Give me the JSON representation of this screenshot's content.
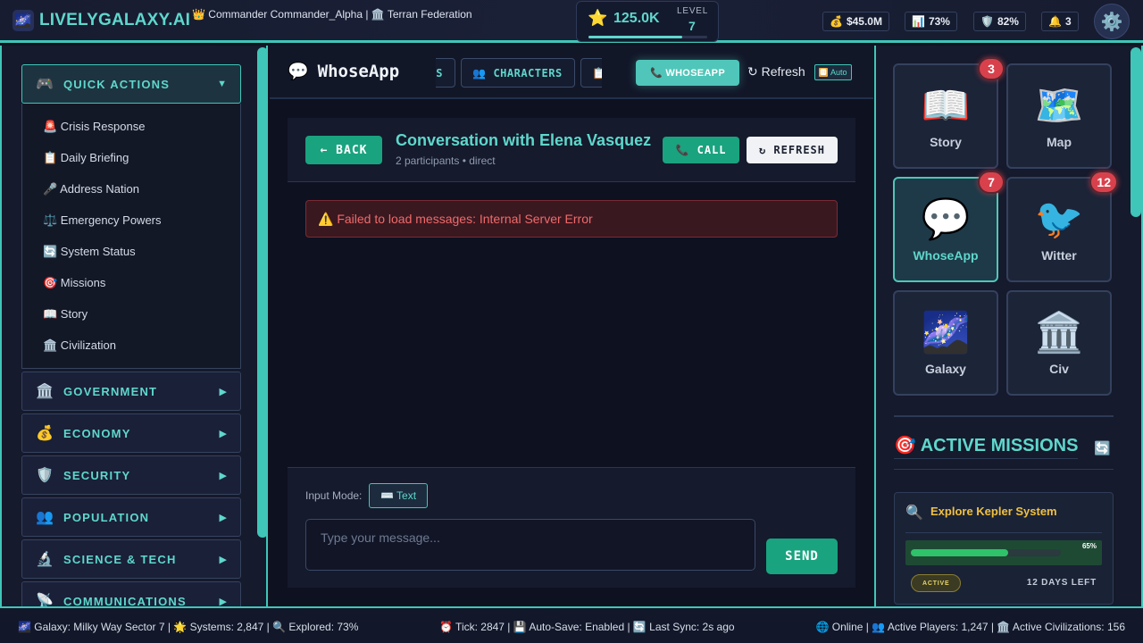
{
  "header": {
    "logo_icon": "🌌",
    "logo_text": "LIVELYGALAXY.AI",
    "commander": "👑 Commander Commander_Alpha | 🏛️ Terran Federation",
    "xp": "125.0K",
    "xp_progress": 0.79,
    "level_label": "LEVEL",
    "level": "7",
    "stats": [
      {
        "icon": "💰",
        "value": "$45.0M"
      },
      {
        "icon": "📊",
        "value": "73%"
      },
      {
        "icon": "🛡️",
        "value": "82%"
      },
      {
        "icon": "🔔",
        "value": "3"
      }
    ],
    "settings_icon": "⚙️"
  },
  "sidebar": {
    "quick_actions": {
      "icon": "🎮",
      "label": "QUICK ACTIONS",
      "arrow": "▼"
    },
    "quick_items": [
      "🚨 Crisis Response",
      "📋 Daily Briefing",
      "🎤 Address Nation",
      "⚖️ Emergency Powers",
      "🔄 System Status",
      "🎯 Missions",
      "📖 Story",
      "🏛️ Civilization"
    ],
    "categories": [
      {
        "icon": "🏛️",
        "label": "GOVERNMENT",
        "arrow": "▶"
      },
      {
        "icon": "💰",
        "label": "ECONOMY",
        "arrow": "▶"
      },
      {
        "icon": "🛡️",
        "label": "SECURITY",
        "arrow": "▶"
      },
      {
        "icon": "👥",
        "label": "POPULATION",
        "arrow": "▶"
      },
      {
        "icon": "🔬",
        "label": "SCIENCE & TECH",
        "arrow": "▶"
      },
      {
        "icon": "📡",
        "label": "COMMUNICATIONS",
        "arrow": "▶"
      }
    ]
  },
  "center": {
    "app_icon": "💬",
    "app_title": "WhoseApp",
    "tabs": [
      {
        "icon": "",
        "label": "S"
      },
      {
        "icon": "👥",
        "label": "CHARACTERS"
      },
      {
        "icon": "📋",
        "label": ""
      }
    ],
    "whoseapp_button": "📞 WHOSEAPP",
    "refresh_link": "↻ Refresh",
    "auto_icon": "🅷",
    "auto_label": "Auto",
    "back_button": "← BACK",
    "conversation_title": "Conversation with Elena Vasquez",
    "conversation_meta": "2 participants • direct",
    "call_button": "📞 CALL",
    "refresh_button": "↻ REFRESH",
    "error": "⚠️ Failed to load messages: Internal Server Error",
    "input_mode_label": "Input Mode:",
    "input_mode_value": "⌨️ Text",
    "message_placeholder": "Type your message...",
    "send_button": "SEND"
  },
  "right": {
    "apps": [
      {
        "emoji": "📖",
        "label": "Story",
        "badge": "3",
        "active": false
      },
      {
        "emoji": "🗺️",
        "label": "Map",
        "badge": "",
        "active": false
      },
      {
        "emoji": "💬",
        "label": "WhoseApp",
        "badge": "7",
        "active": true
      },
      {
        "emoji": "🐦",
        "label": "Witter",
        "badge": "12",
        "active": false
      },
      {
        "emoji": "🌌",
        "label": "Galaxy",
        "badge": "",
        "active": false
      },
      {
        "emoji": "🏛️",
        "label": "Civ",
        "badge": "",
        "active": false
      }
    ],
    "missions_title": "🎯 ACTIVE MISSIONS",
    "missions_refresh": "🔄",
    "mission": {
      "icon": "🔍",
      "name": "Explore Kepler System",
      "progress": 0.65,
      "progress_label": "65%",
      "status": "ACTIVE",
      "days_left": "12 DAYS LEFT"
    }
  },
  "footer": {
    "left": "🌌 Galaxy: Milky Way Sector 7 | 🌟 Systems: 2,847 | 🔍 Explored: 73%",
    "center": "⏰ Tick: 2847 | 💾 Auto-Save: Enabled | 🔄 Last Sync: 2s ago",
    "right": "🌐 Online | 👥 Active Players: 1,247 | 🏛️ Active Civilizations: 156"
  }
}
